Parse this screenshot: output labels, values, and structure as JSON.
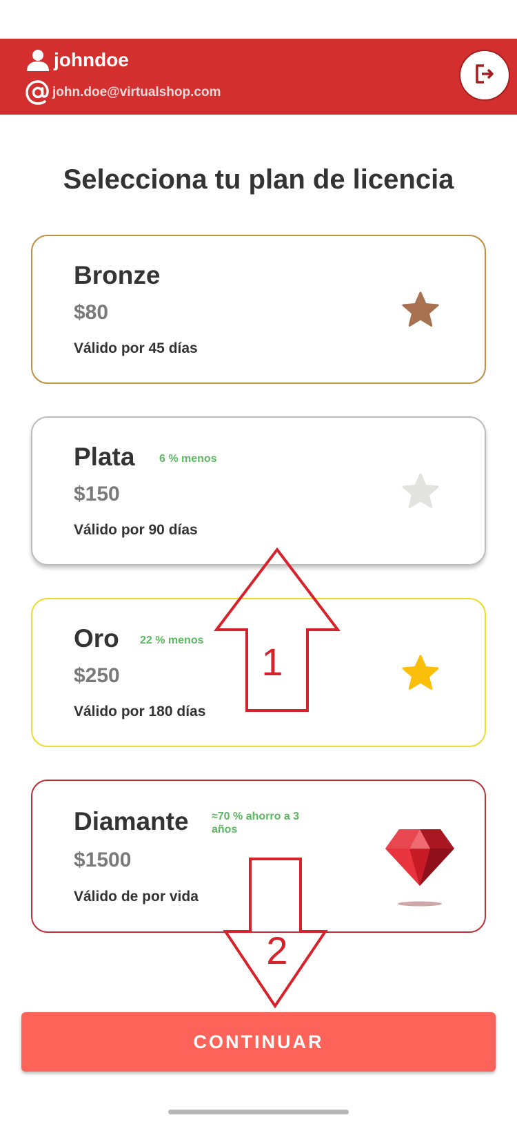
{
  "header": {
    "username": "johndoe",
    "email": "john.doe@virtualshop.com",
    "user_icon": "person-icon",
    "email_icon": "at-icon",
    "logout_icon": "logout-icon",
    "background": "#d32f2f"
  },
  "title": "Selecciona tu plan de licencia",
  "plans": [
    {
      "name": "Bronze",
      "price": "$80",
      "validity": "Válido por 45 días",
      "discount": "",
      "icon": "star-icon",
      "color": "#a8714f",
      "border": "#c19044"
    },
    {
      "name": "Plata",
      "price": "$150",
      "validity": "Válido por 90 días",
      "discount": "6 % menos",
      "icon": "star-icon",
      "color": "#e2e2df",
      "border": "#bdbdbd"
    },
    {
      "name": "Oro",
      "price": "$250",
      "validity": "Válido por 180 días",
      "discount": "22 % menos",
      "icon": "star-icon",
      "color": "#fbbe0a",
      "border": "#eedc2c"
    },
    {
      "name": "Diamante",
      "price": "$1500",
      "validity": "Válido de por vida",
      "discount": "≈70 % ahorro a 3 años",
      "icon": "diamond-icon",
      "color": "#d9252f",
      "border": "#b83438"
    }
  ],
  "continue_label": "CONTINUAR",
  "annotations": {
    "arrow_up_label": "1",
    "arrow_down_label": "2",
    "color": "#d5222b"
  }
}
